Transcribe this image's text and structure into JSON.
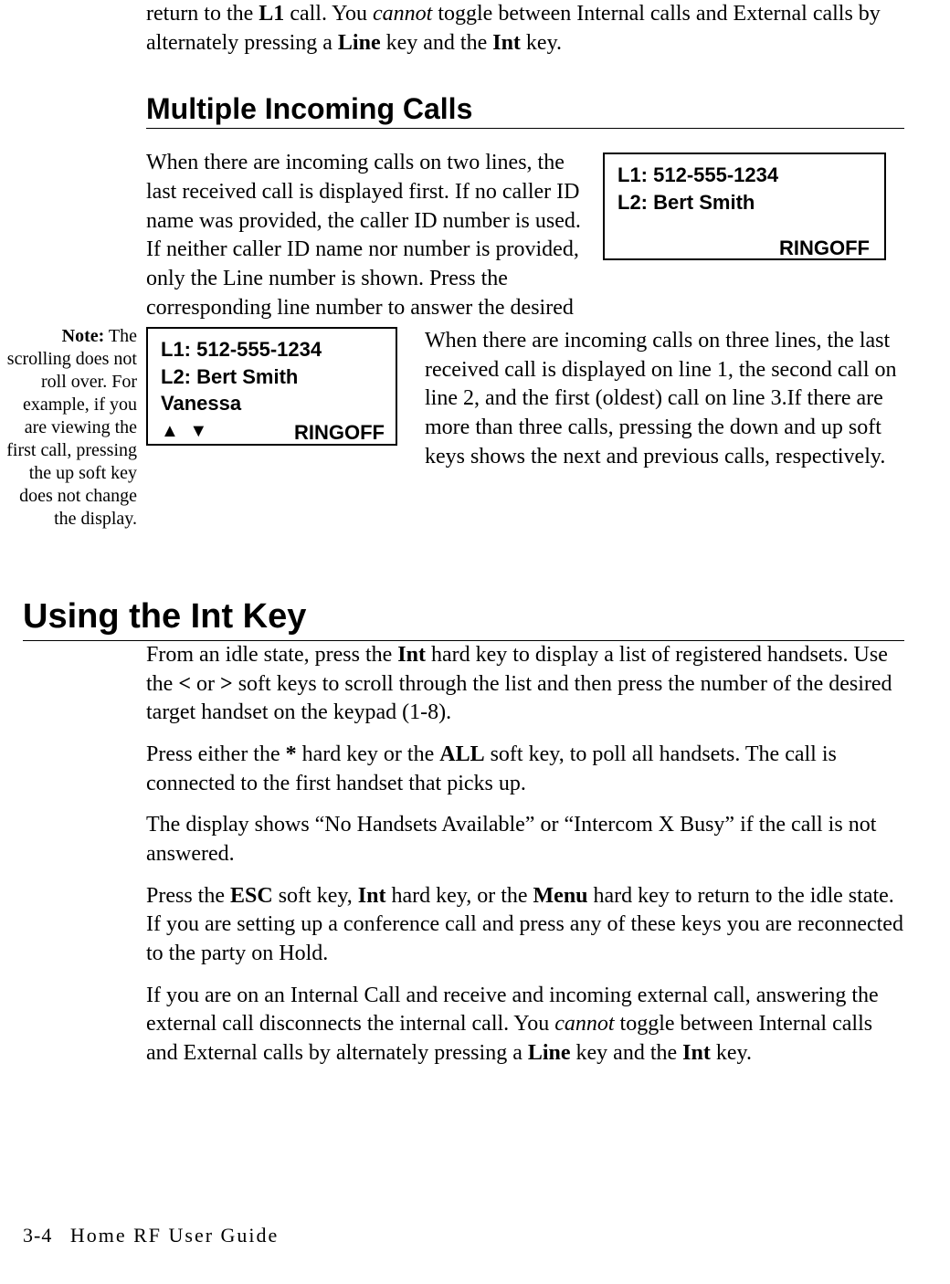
{
  "intro_fragment": {
    "pre": "return to the ",
    "b1": "L1",
    "mid1": " call. You ",
    "i1": "cannot",
    "mid2": " toggle between Internal calls and External calls by alternately pressing a ",
    "b2": "Line",
    "mid3": " key and the ",
    "b3": "Int",
    "end": " key."
  },
  "section1": {
    "heading": "Multiple Incoming Calls",
    "para1": "When there are incoming calls on two lines, the last received call is displayed first. If no caller ID name was provided, the caller ID number is used. If neither caller ID name nor number is provided, only the Line number is shown. Press the corresponding line number to answer the desired call.",
    "para2": "When there are incoming calls on three lines, the last received call is displayed on line 1, the second call on line 2, and the first (oldest) call on line 3.If there are more than three calls, pressing the down and up soft keys shows the next and previous calls, respectively."
  },
  "lcd1": {
    "l1": "L1: 512-555-1234",
    "l2": "L2: Bert Smith",
    "softkey": "RINGOFF"
  },
  "lcd2": {
    "l1": "L1: 512-555-1234",
    "l2": "L2: Bert Smith",
    "l3": "Vanessa",
    "arrows": "▲  ▼",
    "softkey": "RINGOFF"
  },
  "margin_note": {
    "label": "Note:",
    "text": " The scrolling does not roll over. For example, if you are viewing the first call, pressing the up soft key does not change the display."
  },
  "section2": {
    "heading": "Using the Int Key",
    "p1": {
      "t1": "From an idle state, press the ",
      "b1": "Int",
      "t2": " hard key to display a list of registered handsets. Use the ",
      "b2": "<",
      "t3": " or ",
      "b3": ">",
      "t4": " soft keys to scroll through the list and then press the number of the desired target handset on the keypad (1-8)."
    },
    "p2": {
      "t1": "Press either the ",
      "b1": "*",
      "t2": " hard key or the ",
      "b2": "ALL",
      "t3": " soft key, to poll all handsets. The call is connected to the first handset that picks up."
    },
    "p3": "The display shows “No Handsets Available” or “Intercom X Busy” if the call is not answered.",
    "p4": {
      "t1": "Press the ",
      "b1": "ESC",
      "t2": " soft key, ",
      "b2": "Int",
      "t3": " hard key, or the ",
      "b3": "Menu",
      "t4": " hard key to return to the idle state. If you are setting up a conference call and press any of these keys you are reconnected to the party on Hold."
    },
    "p5": {
      "t1": "If you are on an Internal Call and receive and incoming external call, answering the external call disconnects the internal call. You ",
      "i1": "cannot",
      "t2": " toggle between Internal calls and External calls by alternately pressing a ",
      "b1": "Line",
      "t3": " key and the ",
      "b2": "Int",
      "t4": " key."
    }
  },
  "footer": {
    "page": "3-4",
    "title": "Home RF User Guide"
  }
}
